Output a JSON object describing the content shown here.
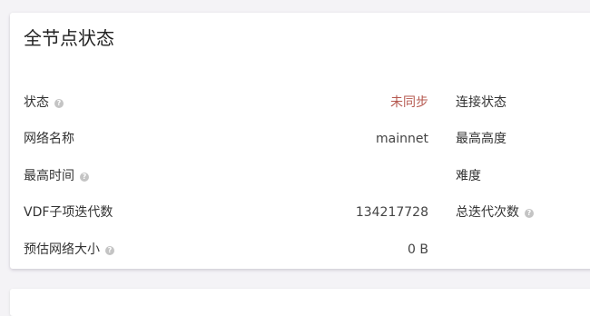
{
  "panel": {
    "title": "全节点状态"
  },
  "rows": [
    {
      "label": "状态",
      "value": "未同步",
      "right_label": "连接状态"
    },
    {
      "label": "网络名称",
      "value": "mainnet",
      "right_label": "最高高度"
    },
    {
      "label": "最高时间",
      "value": "",
      "right_label": "难度"
    },
    {
      "label": "VDF子项迭代数",
      "value": "134217728",
      "right_label": "总迭代次数"
    },
    {
      "label": "预估网络大小",
      "value": "0 B",
      "right_label": ""
    }
  ],
  "help_icon_glyph": "?",
  "colors": {
    "status_not_synced": "#b5584f"
  }
}
